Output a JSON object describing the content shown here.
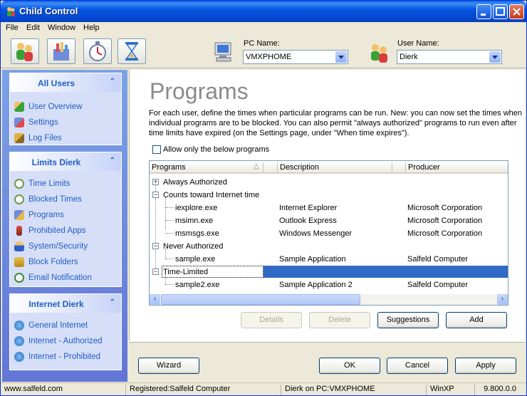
{
  "window": {
    "title": "Child Control"
  },
  "menu": [
    "File",
    "Edit",
    "Window",
    "Help"
  ],
  "toolbar": {
    "pc_label": "PC Name:",
    "pc_value": "VMXPHOME",
    "user_label": "User Name:",
    "user_value": "Dierk"
  },
  "sidebar": {
    "panels": [
      {
        "title": "All Users",
        "items": [
          "User Overview",
          "Settings",
          "Log Files"
        ]
      },
      {
        "title": "Limits Dierk",
        "items": [
          "Time Limits",
          "Blocked Times",
          "Programs",
          "Prohibited Apps",
          "System/Security",
          "Block Folders",
          "Email Notification"
        ]
      },
      {
        "title": "Internet Dierk",
        "items": [
          "General Internet",
          "Internet - Authorized",
          "Internet - Prohibited"
        ]
      }
    ]
  },
  "main": {
    "title": "Programs",
    "description": "For each user, define the times when particular programs can be run. New: you can now set the times when individual programs are to be blocked. You can also permit \"always authorized\" programs to run even after time limits have expired (on the Settings page, under \"When time expires\").",
    "checkbox_label": "Allow only the below programs",
    "columns": [
      "Programs",
      "Description",
      "Producer"
    ],
    "rows": [
      {
        "name": "Always Authorized",
        "description": "",
        "producer": ""
      },
      {
        "name": "Counts toward Internet time",
        "description": "",
        "producer": ""
      },
      {
        "name": "iexplore.exe",
        "description": "Internet Explorer",
        "producer": "Microsoft Corporation"
      },
      {
        "name": "msimn.exe",
        "description": "Outlook Express",
        "producer": "Microsoft Corporation"
      },
      {
        "name": "msmsgs.exe",
        "description": "Windows Messenger",
        "producer": "Microsoft Corporation"
      },
      {
        "name": "Never Authorized",
        "description": "",
        "producer": ""
      },
      {
        "name": "sample.exe",
        "description": "Sample Application",
        "producer": "Salfeld Computer"
      },
      {
        "name": "Time-Limited",
        "description": "",
        "producer": ""
      },
      {
        "name": "sample2.exe",
        "description": "Sample Application 2",
        "producer": "Salfeld Computer"
      }
    ],
    "buttons": {
      "details": "Details",
      "delete": "Delete",
      "suggestions": "Suggestions",
      "add": "Add"
    }
  },
  "footer": {
    "wizard": "Wizard",
    "ok": "OK",
    "cancel": "Cancel",
    "apply": "Apply"
  },
  "status": {
    "website": "www.salfeld.com",
    "registered": "Registered:Salfeld Computer",
    "session": "Dierk on PC:VMXPHOME",
    "os": "WinXP",
    "version": "9.800.0.0"
  }
}
